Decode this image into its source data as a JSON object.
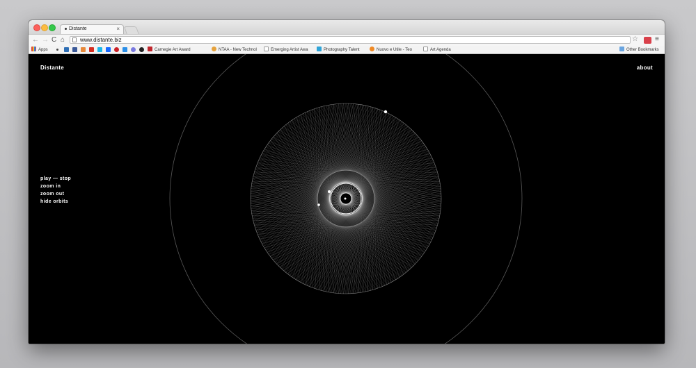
{
  "browser": {
    "tab_title": "Distante",
    "tab_close": "×",
    "url": "www.distante.biz",
    "nav": {
      "back": "←",
      "forward": "→",
      "reload": "C",
      "home": "⌂"
    },
    "star": "☆",
    "menu": "≡"
  },
  "bookmarks": {
    "apps": "Apps",
    "items": [
      {
        "label": "Carnegie Art Award"
      },
      {
        "label": "NTAA - New Technol"
      },
      {
        "label": "Emerging Artist Awa"
      },
      {
        "label": "Photography Talent"
      },
      {
        "label": "Nuovo e Utile - Teo"
      },
      {
        "label": "Art Agenda"
      }
    ],
    "other": "Other Bookmarks"
  },
  "site": {
    "title": "Distante",
    "about": "about",
    "controls": {
      "play_stop": "play — stop",
      "zoom_in": "zoom in",
      "zoom_out": "zoom out",
      "hide_orbits": "hide orbits"
    }
  },
  "colors": {
    "background": "#000000",
    "text": "#ffffff",
    "lines": "#ffffff"
  }
}
